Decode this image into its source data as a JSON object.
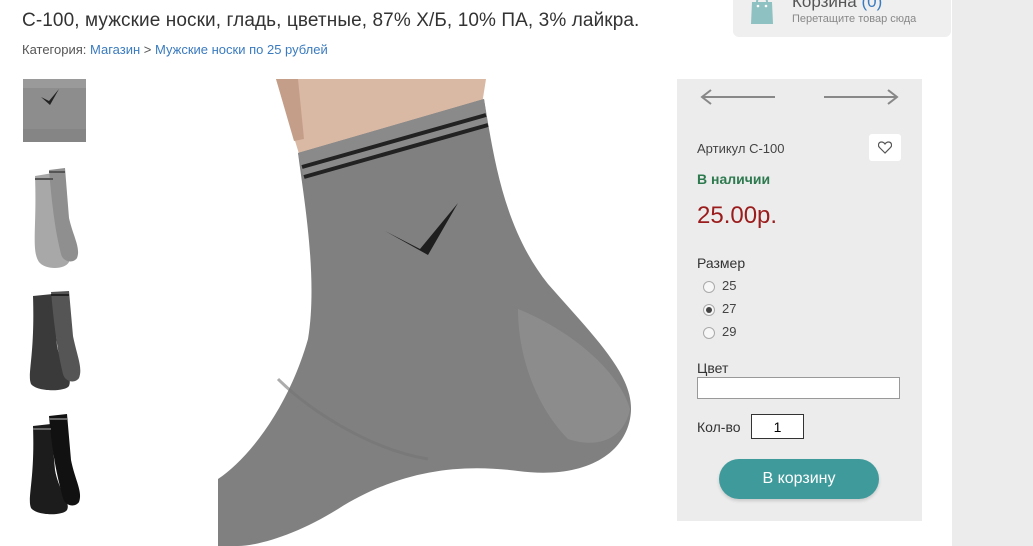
{
  "header": {
    "title": "С-100, мужские носки, гладь, цветные, 87% Х/Б, 10% ПА, 3% лайкра.",
    "breadcrumb": {
      "prefix": "Категория:",
      "shop": "Магазин",
      "separator": ">",
      "category": "Мужские носки по 25 рублей"
    }
  },
  "cart": {
    "label": "Корзина",
    "count": "(0)",
    "hint": "Перетащите товар сюда"
  },
  "gallery": {
    "thumbnails": [
      {
        "icon": "sock-closeup-gray-thumbnail"
      },
      {
        "icon": "sock-gray-light-thumbnail"
      },
      {
        "icon": "sock-dark-gray-thumbnail"
      },
      {
        "icon": "sock-black-thumbnail"
      }
    ],
    "main_image": "gray-sock-on-foot-photo"
  },
  "product": {
    "sku": "Артикул С-100",
    "stock": "В наличии",
    "price": "25.00р.",
    "size_label": "Размер",
    "sizes": [
      {
        "label": "25",
        "checked": false
      },
      {
        "label": "27",
        "checked": true
      },
      {
        "label": "29",
        "checked": false
      }
    ],
    "color_label": "Цвет",
    "color_value": "",
    "qty_label": "Кол-во",
    "qty_value": "1",
    "buy_label": "В корзину"
  },
  "colors": {
    "accent": "#3f9a9b",
    "price": "#9b1c1c",
    "stock": "#2e7a4f",
    "link": "#3a7bbf"
  }
}
